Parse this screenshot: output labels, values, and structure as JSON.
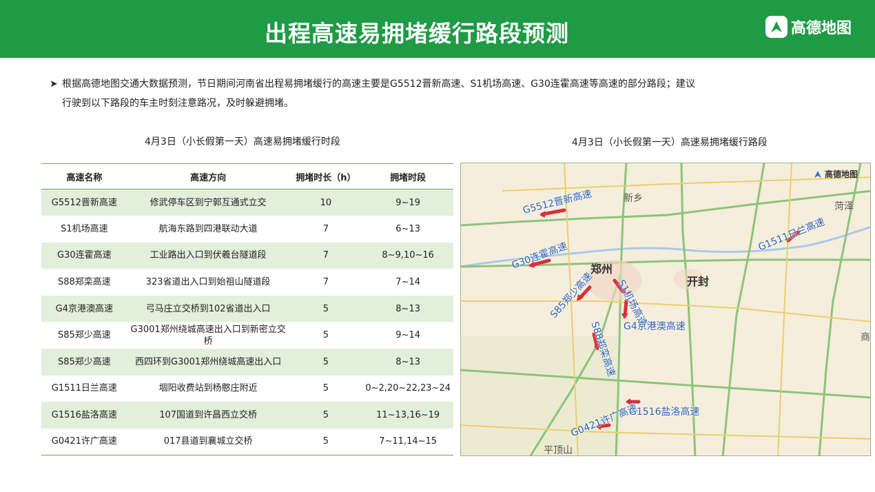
{
  "header": {
    "title": "出程高速易拥堵缓行路段预测",
    "brand": "高德地图",
    "color": "#1f9a45"
  },
  "intro": {
    "bullet": "➤",
    "line1": "根据高德地图交通大数据预测，节日期间河南省出程易拥堵缓行的高速主要是G5512晋新高速、S1机场高速、G30连霍高速等高速的部分路段；建议",
    "line2": "行驶到以下路段的车主时刻注意路况，及时躲避拥堵。"
  },
  "table": {
    "caption": "4月3日（小长假第一天）高速易拥堵缓行时段",
    "headers": [
      "高速名称",
      "高速方向",
      "拥堵时长（h）",
      "拥堵时段"
    ],
    "rows": [
      [
        "G5512晋新高速",
        "修武停车区到宁郭互通式立交",
        "10",
        "9~19"
      ],
      [
        "S1机场高速",
        "航海东路到四港联动大道",
        "7",
        "6~13"
      ],
      [
        "G30连霍高速",
        "工业路出入口到伏羲台隧道段",
        "7",
        "8~9,10~16"
      ],
      [
        "S88郑栾高速",
        "323省道出入口到始祖山隧道段",
        "7",
        "7~14"
      ],
      [
        "G4京港澳高速",
        "弓马庄立交桥到102省道出入口",
        "5",
        "8~13"
      ],
      [
        "S85郑少高速",
        "G3001郑州绕城高速出入口到新密立交桥",
        "5",
        "9~14"
      ],
      [
        "S85郑少高速",
        "西四环到G3001郑州绕城高速出入口",
        "5",
        "8~13"
      ],
      [
        "G1511日兰高速",
        "堌阳收费站到杨憨庄附近",
        "5",
        "0~2,20~22,23~24"
      ],
      [
        "G1516盐洛高速",
        "107国道到许昌西立交桥",
        "5",
        "11~13,16~19"
      ],
      [
        "G0421许广高速",
        "017县道到襄城立交桥",
        "5",
        "7~11,14~15"
      ]
    ],
    "stripe_color": "#e2efda"
  },
  "map": {
    "caption": "4月3日（小长假第一天）高速易拥堵缓行路段",
    "logo": "高德地图",
    "route_labels": {
      "g5512": "G5512晋新高速",
      "g30": "G30连霍高速",
      "s85": "S85郑少高速",
      "s1": "S1机场高速",
      "g4": "G4京港澳高速",
      "s88": "S88郑栾高速",
      "g1511": "G1511日兰高速",
      "g0421": "G0421许广高速",
      "g1516": "G1516盐洛高速"
    },
    "cities": {
      "zhengzhou": "郑州",
      "kaifeng": "开封",
      "xinxiang": "新乡",
      "heze": "菏泽",
      "pingdingshan": "平顶山",
      "shang": "商"
    },
    "congestion_color": "#d6303c"
  }
}
